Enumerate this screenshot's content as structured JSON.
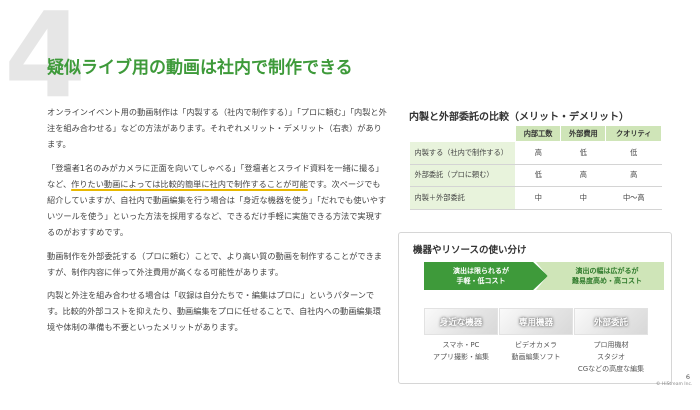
{
  "slide": {
    "section_number": "4",
    "title": "疑似ライブ用の動画は社内で制作できる",
    "page_number": "6",
    "copyright": "© HiStream Inc."
  },
  "body": {
    "p1": "オンラインイベント用の動画制作は「内製する（社内で制作する）」「プロに頼む」「内製と外注を組み合わせる」などの方法があります。それぞれメリット・デメリット（右表）があります。",
    "p2_before": "「登壇者1名のみがカメラに正面を向いてしゃべる」「登壇者とスライド資料を一緒に撮る」など、",
    "p2_highlight": "作りたい動画によっては比較的簡単に社内で制作することが可能",
    "p2_after": "です。次ページでも紹介していますが、自社内で動画編集を行う場合は「身近な機器を使う」「だれでも使いやすいツールを使う」といった方法を採用するなど、できるだけ手軽に実施できる方法で実現するのがおすすめです。",
    "p3": "動画制作を外部委託する（プロに頼む）ことで、より高い質の動画を制作することができますが、制作内容に伴って外注費用が高くなる可能性があります。",
    "p4": "内製と外注を組み合わせる場合は「収録は自分たちで・編集はプロに」というパターンです。比較的外部コストを抑えたり、動画編集をプロに任せることで、自社内への動画編集環境や体制の準備も不要といったメリットがあります。"
  },
  "comparison": {
    "title": "内製と外部委託の比較（メリット・デメリット）",
    "headers": [
      "内部工数",
      "外部費用",
      "クオリティ"
    ],
    "rows": [
      {
        "label": "内製する（社内で制作する）",
        "values": [
          "高",
          "低",
          "低"
        ]
      },
      {
        "label": "外部委託（プロに頼む）",
        "values": [
          "低",
          "高",
          "高"
        ]
      },
      {
        "label": "内製＋外部委託",
        "values": [
          "中",
          "中",
          "中〜高"
        ]
      }
    ]
  },
  "resources": {
    "title": "機器やリソースの使い分け",
    "arrow_left": [
      "演出は限られるが",
      "手軽・低コスト"
    ],
    "arrow_right": [
      "演出の幅は広がるが",
      "難易度高め・高コスト"
    ],
    "items": [
      {
        "label": "身近な機器",
        "caption": [
          "スマホ・PC",
          "アプリ撮影・編集"
        ]
      },
      {
        "label": "専用機器",
        "caption": [
          "ビデオカメラ",
          "動画編集ソフト"
        ]
      },
      {
        "label": "外部委託",
        "caption": [
          "プロ用機材",
          "スタジオ",
          "CGなどの高度な編集"
        ]
      }
    ]
  },
  "colors": {
    "accent_green": "#3e9a3a",
    "light_green": "#cfe5b8",
    "highlight_underline": "#e8b800"
  }
}
